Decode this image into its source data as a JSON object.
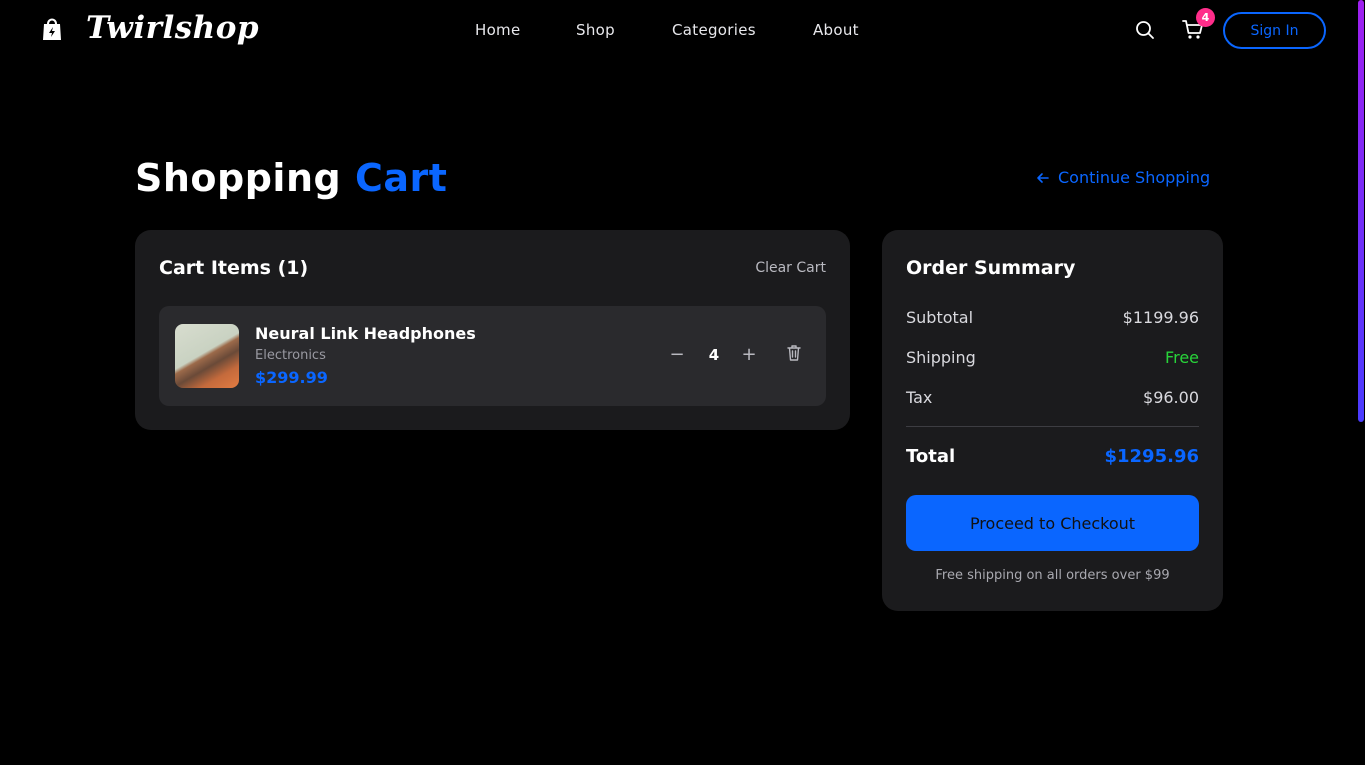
{
  "header": {
    "logo_text": "Twirlshop",
    "nav": [
      "Home",
      "Shop",
      "Categories",
      "About"
    ],
    "cart_count": "4",
    "sign_in_label": "Sign In"
  },
  "page": {
    "title_main": "Shopping",
    "title_accent": "Cart",
    "continue_label": "Continue Shopping"
  },
  "cart": {
    "heading": "Cart Items (1)",
    "clear_label": "Clear Cart",
    "items": [
      {
        "name": "Neural Link Headphones",
        "category": "Electronics",
        "price": "$299.99",
        "quantity": "4",
        "minus": "−",
        "plus": "+"
      }
    ]
  },
  "summary": {
    "heading": "Order Summary",
    "subtotal_label": "Subtotal",
    "subtotal_value": "$1199.96",
    "shipping_label": "Shipping",
    "shipping_value": "Free",
    "tax_label": "Tax",
    "tax_value": "$96.00",
    "total_label": "Total",
    "total_value": "$1295.96",
    "checkout_label": "Proceed to Checkout",
    "shipping_note": "Free shipping on all orders over $99"
  },
  "icons": {
    "logo": "shopping-bag-icon",
    "search": "search-icon",
    "cart": "cart-icon",
    "back": "arrow-left-icon",
    "remove": "trash-icon"
  },
  "colors": {
    "accent": "#0a66ff",
    "badge": "#ff2d8a",
    "free": "#28d43a",
    "panel": "#1b1b1d"
  }
}
